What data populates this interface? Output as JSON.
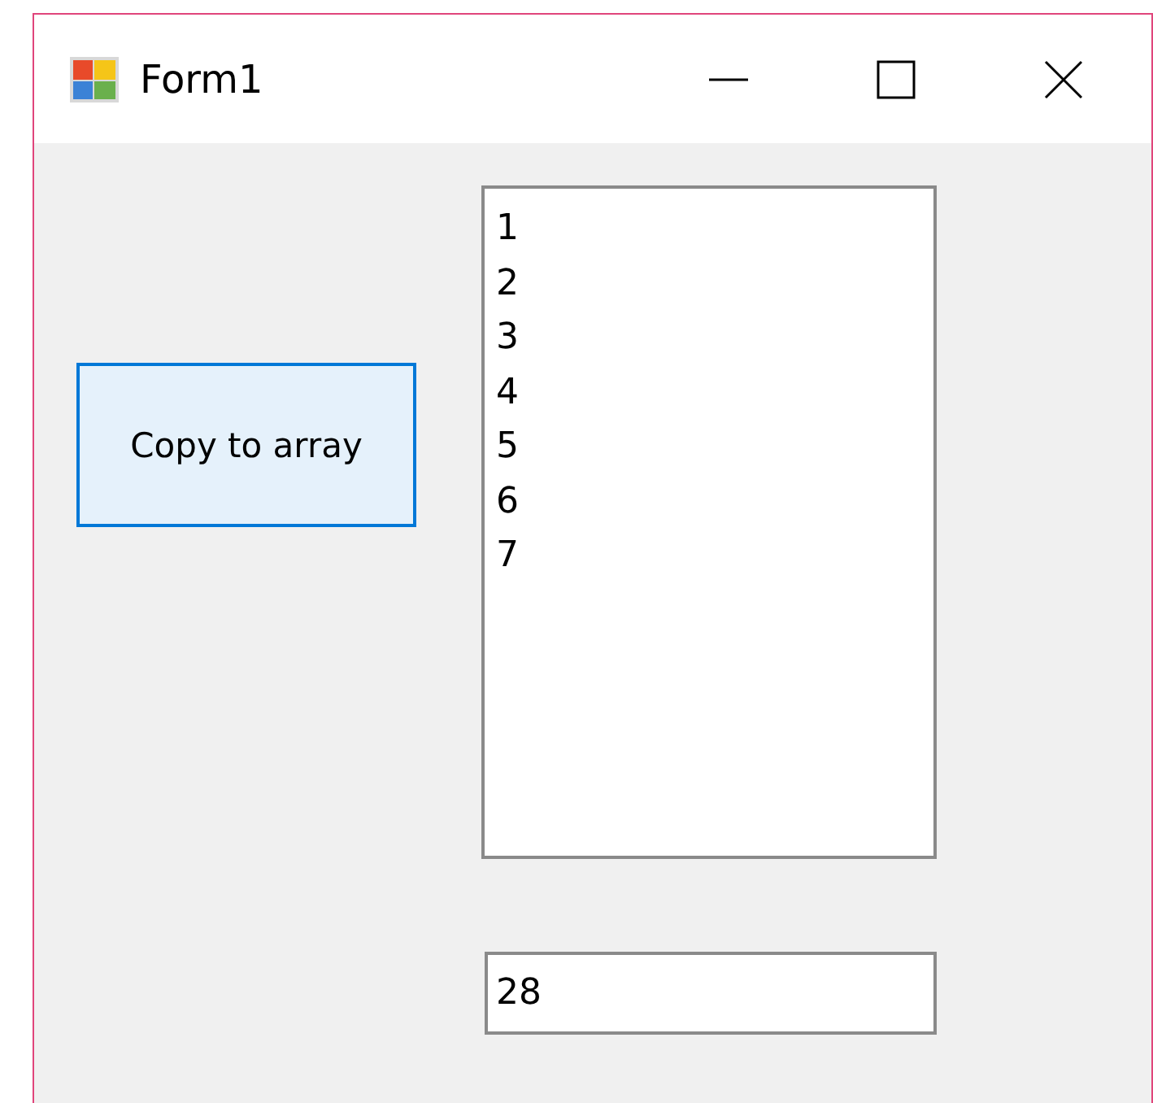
{
  "window": {
    "title": "Form1"
  },
  "copy_button": {
    "label": "Copy to array"
  },
  "listbox": {
    "items": [
      "1",
      "2",
      "3",
      "4",
      "5",
      "6",
      "7"
    ]
  },
  "textbox": {
    "value": "28"
  }
}
